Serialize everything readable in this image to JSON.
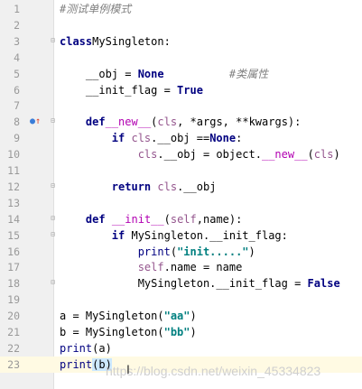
{
  "editor": {
    "lines": [
      {
        "n": "1",
        "t": [
          [
            "cm",
            "#测试单例模式"
          ]
        ]
      },
      {
        "n": "2",
        "t": []
      },
      {
        "n": "3",
        "t": [
          [
            "kw",
            "class"
          ],
          [
            "",
            "MySingleton:"
          ]
        ]
      },
      {
        "n": "4",
        "t": []
      },
      {
        "n": "5",
        "t": [
          [
            "",
            "    __obj = "
          ],
          [
            "kw",
            "None"
          ],
          [
            "",
            "          "
          ],
          [
            "cm",
            "#类属性"
          ]
        ]
      },
      {
        "n": "6",
        "t": [
          [
            "",
            "    __init_flag = "
          ],
          [
            "kw",
            "True"
          ]
        ]
      },
      {
        "n": "7",
        "t": []
      },
      {
        "n": "8",
        "t": [
          [
            "",
            "    "
          ],
          [
            "kw",
            "def"
          ],
          [
            "",
            ""
          ],
          [
            "magic",
            "__new__"
          ],
          [
            "",
            "("
          ],
          [
            "self",
            "cls"
          ],
          [
            "",
            ", *args, **kwargs):"
          ]
        ]
      },
      {
        "n": "9",
        "t": [
          [
            "",
            "        "
          ],
          [
            "kw",
            "if"
          ],
          [
            "",
            " "
          ],
          [
            "self",
            "cls"
          ],
          [
            "",
            ".__obj =="
          ],
          [
            "kw",
            "None"
          ],
          [
            "",
            ":"
          ]
        ]
      },
      {
        "n": "10",
        "t": [
          [
            "",
            "            "
          ],
          [
            "self",
            "cls"
          ],
          [
            "",
            ".__obj = object."
          ],
          [
            "magic",
            "__new__"
          ],
          [
            "",
            "("
          ],
          [
            "self",
            "cls"
          ],
          [
            "",
            ")"
          ]
        ]
      },
      {
        "n": "11",
        "t": []
      },
      {
        "n": "12",
        "t": [
          [
            "",
            "        "
          ],
          [
            "kw",
            "return"
          ],
          [
            "",
            " "
          ],
          [
            "self",
            "cls"
          ],
          [
            "",
            ".__obj"
          ]
        ]
      },
      {
        "n": "13",
        "t": []
      },
      {
        "n": "14",
        "t": [
          [
            "",
            "    "
          ],
          [
            "kw",
            "def"
          ],
          [
            "",
            " "
          ],
          [
            "magic",
            "__init__"
          ],
          [
            "",
            "("
          ],
          [
            "self",
            "self"
          ],
          [
            "",
            ",name):"
          ]
        ]
      },
      {
        "n": "15",
        "t": [
          [
            "",
            "        "
          ],
          [
            "kw",
            "if"
          ],
          [
            "",
            " MySingleton.__init_flag:"
          ]
        ]
      },
      {
        "n": "16",
        "t": [
          [
            "",
            "            "
          ],
          [
            "bi",
            "print"
          ],
          [
            "",
            "("
          ],
          [
            "str",
            "\"init.....\""
          ],
          [
            "",
            ")"
          ]
        ]
      },
      {
        "n": "17",
        "t": [
          [
            "",
            "            "
          ],
          [
            "self",
            "self"
          ],
          [
            "",
            ".name = name"
          ]
        ]
      },
      {
        "n": "18",
        "t": [
          [
            "",
            "            MySingleton.__init_flag = "
          ],
          [
            "kw",
            "False"
          ]
        ]
      },
      {
        "n": "19",
        "t": []
      },
      {
        "n": "20",
        "t": [
          [
            "",
            "a = MySingleton("
          ],
          [
            "str",
            "\"aa\""
          ],
          [
            "",
            ")"
          ]
        ]
      },
      {
        "n": "21",
        "t": [
          [
            "",
            "b = MySingleton("
          ],
          [
            "str",
            "\"bb\""
          ],
          [
            "",
            ")"
          ]
        ]
      },
      {
        "n": "22",
        "t": [
          [
            "bi",
            "print"
          ],
          [
            "",
            "(a)"
          ]
        ]
      },
      {
        "n": "23",
        "t": [
          [
            "bi",
            "print"
          ],
          [
            "hl",
            "(b)"
          ]
        ]
      }
    ],
    "current_line": "23"
  },
  "watermark": "https://blog.csdn.net/weixin_45334823",
  "colors": {
    "keyword": "#000080",
    "comment": "#808080",
    "string": "#008080",
    "self": "#94558d",
    "magic": "#b200b2",
    "gutter": "#f0f0f0",
    "current_line": "#fffae3"
  },
  "gutter_icons": {
    "override_marker": "override-icon",
    "fold_markers": "fold-icon"
  }
}
